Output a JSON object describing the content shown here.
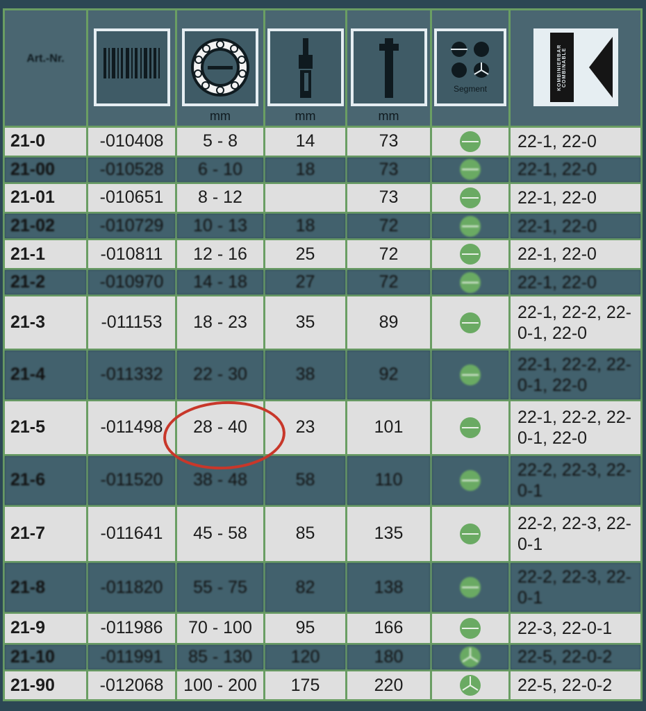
{
  "header": {
    "col_art_label": "Art.-Nr.",
    "col_unit_diameter": "mm",
    "col_unit_length": "mm",
    "col_unit_height": "mm",
    "col_segment_label": "Segment",
    "col_kombi_label": "KOMBINIERBAR COMBINABLE",
    "icons": [
      "barcode-icon",
      "bearing-ring-icon",
      "bolt-length-icon",
      "bolt-height-icon",
      "segment-icon",
      "combinable-icon"
    ]
  },
  "rows": [
    {
      "art": "21-0",
      "code": "-010408",
      "range": "5 - 8",
      "a": "14",
      "b": "73",
      "seg": "half",
      "komb": "22-1, 22-0",
      "style": "light"
    },
    {
      "art": "21-00",
      "code": "-010528",
      "range": "6 - 10",
      "a": "18",
      "b": "73",
      "seg": "half",
      "komb": "22-1, 22-0",
      "style": "dark"
    },
    {
      "art": "21-01",
      "code": "-010651",
      "range": "8 - 12",
      "a": "",
      "b": "73",
      "seg": "half",
      "komb": "22-1, 22-0",
      "style": "light"
    },
    {
      "art": "21-02",
      "code": "-010729",
      "range": "10 - 13",
      "a": "18",
      "b": "72",
      "seg": "half",
      "komb": "22-1, 22-0",
      "style": "dark"
    },
    {
      "art": "21-1",
      "code": "-010811",
      "range": "12 - 16",
      "a": "25",
      "b": "72",
      "seg": "half",
      "komb": "22-1, 22-0",
      "style": "light"
    },
    {
      "art": "21-2",
      "code": "-010970",
      "range": "14 - 18",
      "a": "27",
      "b": "72",
      "seg": "half",
      "komb": "22-1, 22-0",
      "style": "dark"
    },
    {
      "art": "21-3",
      "code": "-011153",
      "range": "18 - 23",
      "a": "35",
      "b": "89",
      "seg": "half",
      "komb": "22-1, 22-2, 22-0-1, 22-0",
      "style": "light"
    },
    {
      "art": "21-4",
      "code": "-011332",
      "range": "22 - 30",
      "a": "38",
      "b": "92",
      "seg": "half",
      "komb": "22-1, 22-2, 22-0-1, 22-0",
      "style": "dark"
    },
    {
      "art": "21-5",
      "code": "-011498",
      "range": "28 - 40",
      "a": "23",
      "b": "101",
      "seg": "half",
      "komb": "22-1, 22-2, 22-0-1, 22-0",
      "style": "light"
    },
    {
      "art": "21-6",
      "code": "-011520",
      "range": "38 - 48",
      "a": "58",
      "b": "110",
      "seg": "half",
      "komb": "22-2, 22-3, 22-0-1",
      "style": "dark"
    },
    {
      "art": "21-7",
      "code": "-011641",
      "range": "45 - 58",
      "a": "85",
      "b": "135",
      "seg": "half",
      "komb": "22-2, 22-3, 22-0-1",
      "style": "light"
    },
    {
      "art": "21-8",
      "code": "-011820",
      "range": "55 - 75",
      "a": "82",
      "b": "138",
      "seg": "half",
      "komb": "22-2, 22-3, 22-0-1",
      "style": "dark"
    },
    {
      "art": "21-9",
      "code": "-011986",
      "range": "70 - 100",
      "a": "95",
      "b": "166",
      "seg": "half",
      "komb": "22-3, 22-0-1",
      "style": "light"
    },
    {
      "art": "21-10",
      "code": "-011991",
      "range": "85 - 130",
      "a": "120",
      "b": "180",
      "seg": "third",
      "komb": "22-5, 22-0-2",
      "style": "dark"
    },
    {
      "art": "21-90",
      "code": "-012068",
      "range": "100 - 200",
      "a": "175",
      "b": "220",
      "seg": "third",
      "komb": "22-5, 22-0-2",
      "style": "light"
    }
  ],
  "colors": {
    "background": "#2c4754",
    "grid": "#6a9e63",
    "light_row": "#dfdfdf",
    "dark_row": "#42616d",
    "segment_dot": "#6aaa63",
    "annotation": "#c8372a"
  }
}
